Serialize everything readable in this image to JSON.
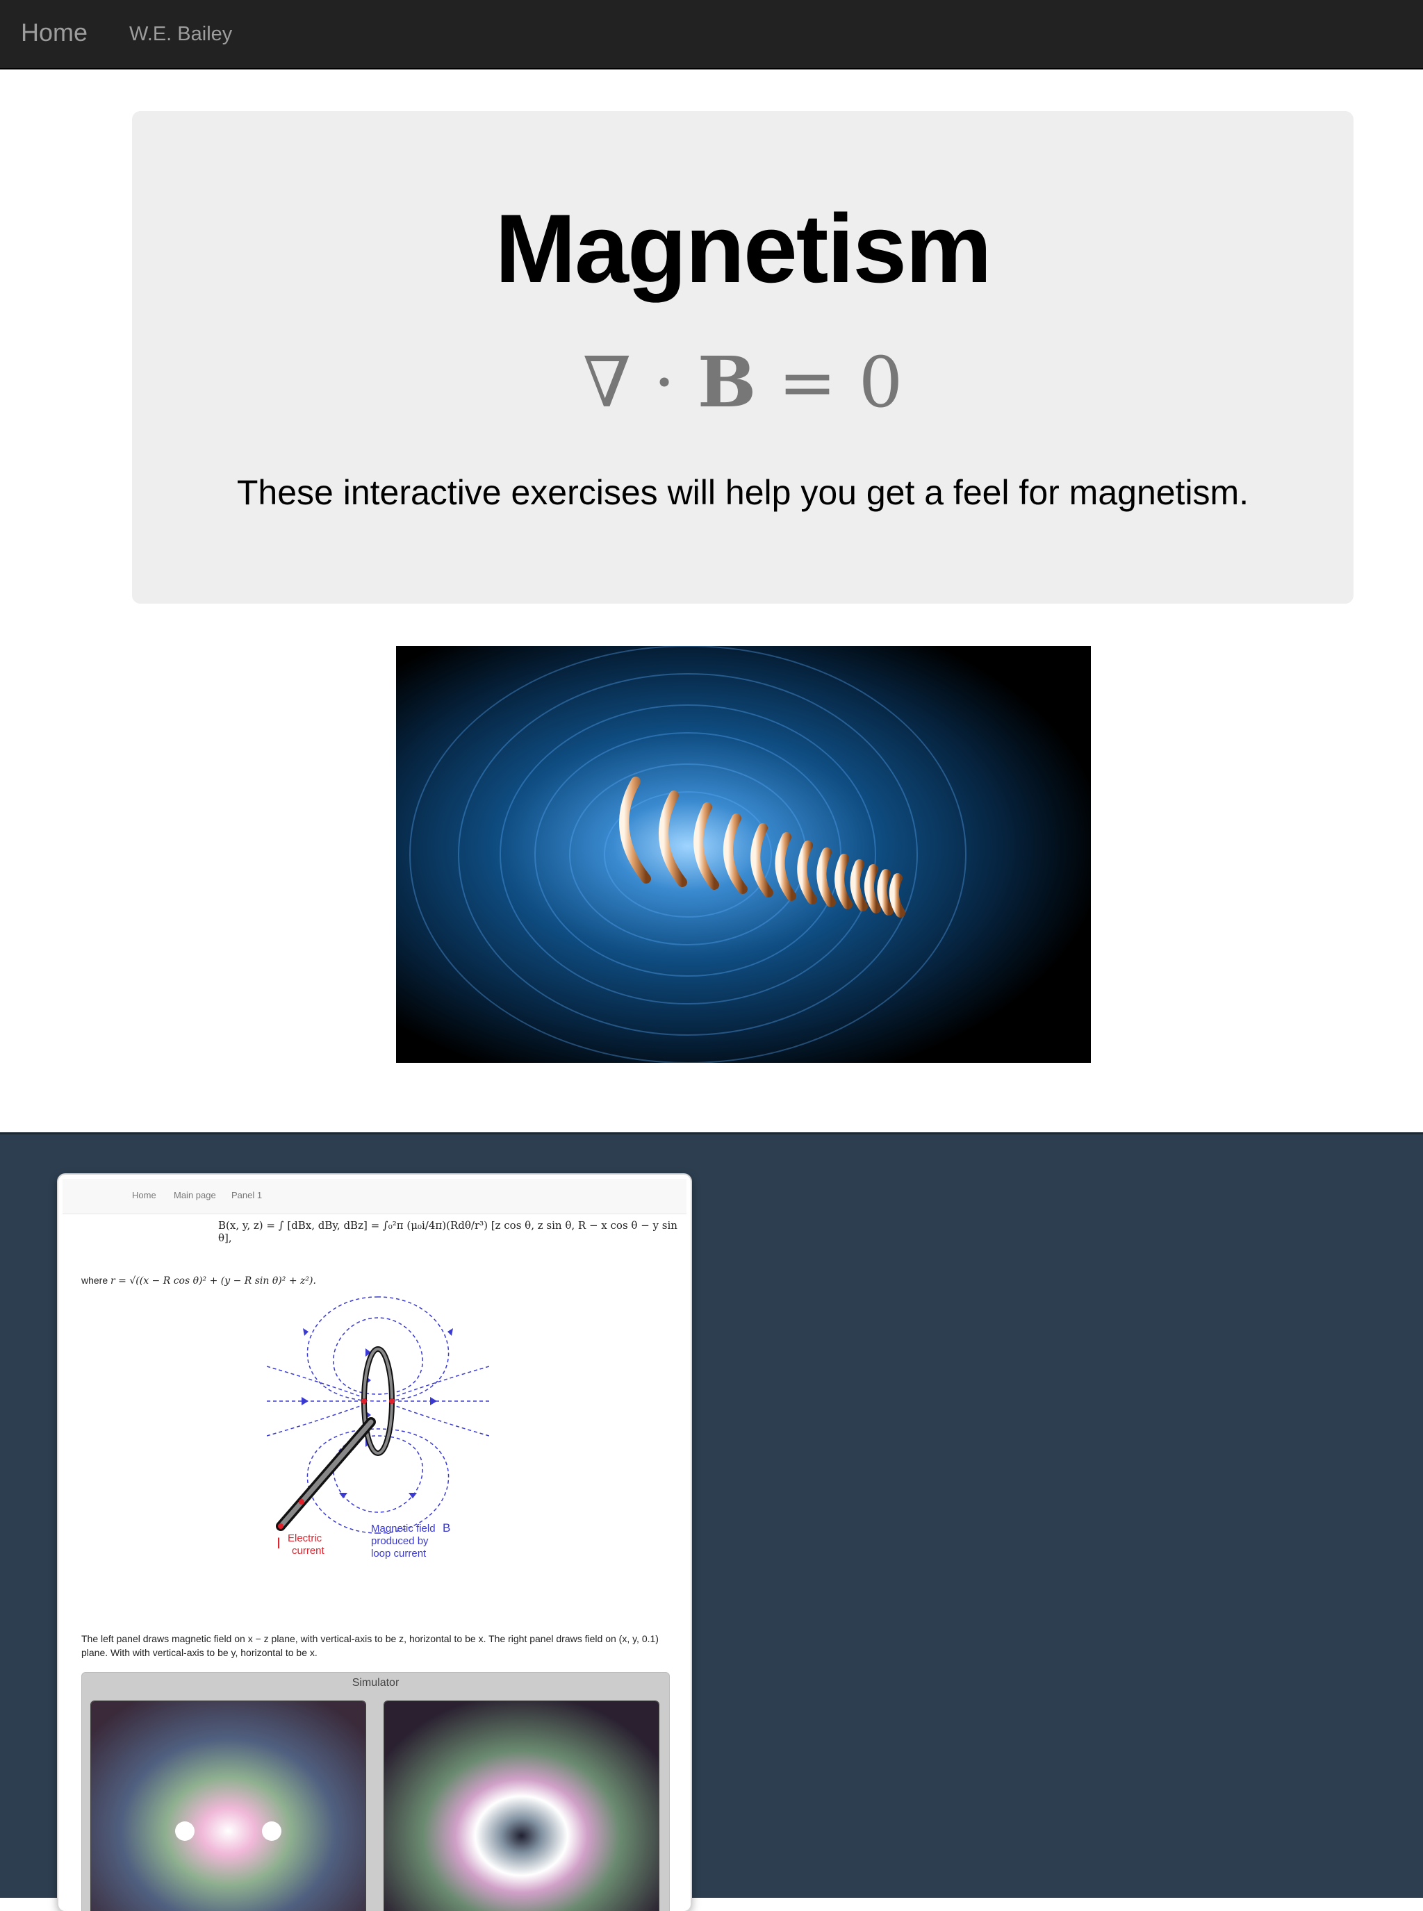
{
  "navbar": {
    "home": "Home",
    "author": "W.E. Bailey"
  },
  "hero": {
    "title": "Magnetism",
    "equation_nabla": "∇",
    "equation_dot": " · ",
    "equation_B": "B",
    "equation_rest": " = 0",
    "lead": "These interactive exercises will help you get a feel for magnetism."
  },
  "card": {
    "nav": [
      "Home",
      "Main page",
      "Panel 1"
    ],
    "formula": "B(x, y, z) = ∫ [dBx, dBy, dBz] = ∫₀²π (μ₀i/4π)(Rdθ/r³) [z cos θ, z sin θ, R − x cos θ − y sin θ],",
    "where_prefix": "where ",
    "where_formula": "r = √((x − R cos θ)² + (y − R sin θ)² + z²).",
    "diagram_current_label_1": "Electric",
    "diagram_current_label_2": "current",
    "diagram_current_symbol": "I",
    "diagram_field_label_1": "Magnetic field",
    "diagram_field_symbol": "B",
    "diagram_field_label_2": "produced by",
    "diagram_field_label_3": "loop current",
    "caption": "The left panel draws magnetic field on x − z plane, with vertical-axis to be z, horizontal to be x. The right panel draws field on (x, y, 0.1) plane. With with vertical-axis to be y, horizontal to be x.",
    "simulator_title": "Simulator"
  },
  "colors": {
    "navbar": "#222222",
    "hero_bg": "#eeeeee",
    "lower_bg": "#2c3e50",
    "current_red": "#e0202a",
    "field_blue": "#3a3ad0"
  }
}
